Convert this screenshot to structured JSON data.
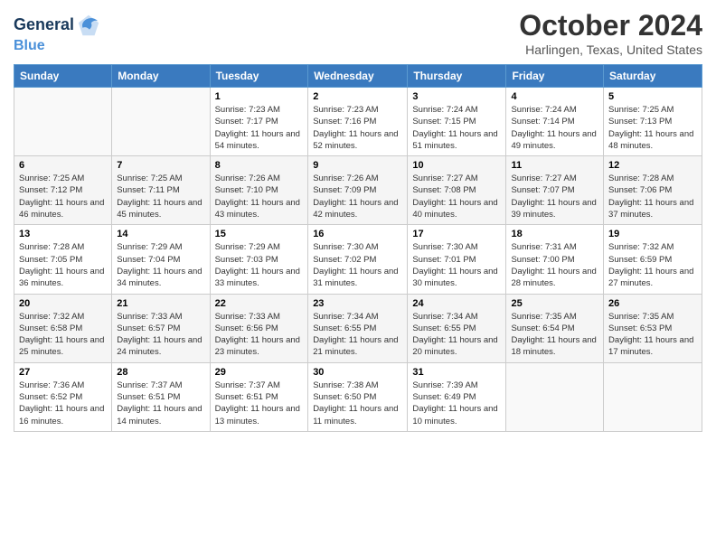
{
  "header": {
    "logo_line1": "General",
    "logo_line2": "Blue",
    "month_title": "October 2024",
    "location": "Harlingen, Texas, United States"
  },
  "weekdays": [
    "Sunday",
    "Monday",
    "Tuesday",
    "Wednesday",
    "Thursday",
    "Friday",
    "Saturday"
  ],
  "weeks": [
    [
      {
        "day": "",
        "sunrise": "",
        "sunset": "",
        "daylight": ""
      },
      {
        "day": "",
        "sunrise": "",
        "sunset": "",
        "daylight": ""
      },
      {
        "day": "1",
        "sunrise": "Sunrise: 7:23 AM",
        "sunset": "Sunset: 7:17 PM",
        "daylight": "Daylight: 11 hours and 54 minutes."
      },
      {
        "day": "2",
        "sunrise": "Sunrise: 7:23 AM",
        "sunset": "Sunset: 7:16 PM",
        "daylight": "Daylight: 11 hours and 52 minutes."
      },
      {
        "day": "3",
        "sunrise": "Sunrise: 7:24 AM",
        "sunset": "Sunset: 7:15 PM",
        "daylight": "Daylight: 11 hours and 51 minutes."
      },
      {
        "day": "4",
        "sunrise": "Sunrise: 7:24 AM",
        "sunset": "Sunset: 7:14 PM",
        "daylight": "Daylight: 11 hours and 49 minutes."
      },
      {
        "day": "5",
        "sunrise": "Sunrise: 7:25 AM",
        "sunset": "Sunset: 7:13 PM",
        "daylight": "Daylight: 11 hours and 48 minutes."
      }
    ],
    [
      {
        "day": "6",
        "sunrise": "Sunrise: 7:25 AM",
        "sunset": "Sunset: 7:12 PM",
        "daylight": "Daylight: 11 hours and 46 minutes."
      },
      {
        "day": "7",
        "sunrise": "Sunrise: 7:25 AM",
        "sunset": "Sunset: 7:11 PM",
        "daylight": "Daylight: 11 hours and 45 minutes."
      },
      {
        "day": "8",
        "sunrise": "Sunrise: 7:26 AM",
        "sunset": "Sunset: 7:10 PM",
        "daylight": "Daylight: 11 hours and 43 minutes."
      },
      {
        "day": "9",
        "sunrise": "Sunrise: 7:26 AM",
        "sunset": "Sunset: 7:09 PM",
        "daylight": "Daylight: 11 hours and 42 minutes."
      },
      {
        "day": "10",
        "sunrise": "Sunrise: 7:27 AM",
        "sunset": "Sunset: 7:08 PM",
        "daylight": "Daylight: 11 hours and 40 minutes."
      },
      {
        "day": "11",
        "sunrise": "Sunrise: 7:27 AM",
        "sunset": "Sunset: 7:07 PM",
        "daylight": "Daylight: 11 hours and 39 minutes."
      },
      {
        "day": "12",
        "sunrise": "Sunrise: 7:28 AM",
        "sunset": "Sunset: 7:06 PM",
        "daylight": "Daylight: 11 hours and 37 minutes."
      }
    ],
    [
      {
        "day": "13",
        "sunrise": "Sunrise: 7:28 AM",
        "sunset": "Sunset: 7:05 PM",
        "daylight": "Daylight: 11 hours and 36 minutes."
      },
      {
        "day": "14",
        "sunrise": "Sunrise: 7:29 AM",
        "sunset": "Sunset: 7:04 PM",
        "daylight": "Daylight: 11 hours and 34 minutes."
      },
      {
        "day": "15",
        "sunrise": "Sunrise: 7:29 AM",
        "sunset": "Sunset: 7:03 PM",
        "daylight": "Daylight: 11 hours and 33 minutes."
      },
      {
        "day": "16",
        "sunrise": "Sunrise: 7:30 AM",
        "sunset": "Sunset: 7:02 PM",
        "daylight": "Daylight: 11 hours and 31 minutes."
      },
      {
        "day": "17",
        "sunrise": "Sunrise: 7:30 AM",
        "sunset": "Sunset: 7:01 PM",
        "daylight": "Daylight: 11 hours and 30 minutes."
      },
      {
        "day": "18",
        "sunrise": "Sunrise: 7:31 AM",
        "sunset": "Sunset: 7:00 PM",
        "daylight": "Daylight: 11 hours and 28 minutes."
      },
      {
        "day": "19",
        "sunrise": "Sunrise: 7:32 AM",
        "sunset": "Sunset: 6:59 PM",
        "daylight": "Daylight: 11 hours and 27 minutes."
      }
    ],
    [
      {
        "day": "20",
        "sunrise": "Sunrise: 7:32 AM",
        "sunset": "Sunset: 6:58 PM",
        "daylight": "Daylight: 11 hours and 25 minutes."
      },
      {
        "day": "21",
        "sunrise": "Sunrise: 7:33 AM",
        "sunset": "Sunset: 6:57 PM",
        "daylight": "Daylight: 11 hours and 24 minutes."
      },
      {
        "day": "22",
        "sunrise": "Sunrise: 7:33 AM",
        "sunset": "Sunset: 6:56 PM",
        "daylight": "Daylight: 11 hours and 23 minutes."
      },
      {
        "day": "23",
        "sunrise": "Sunrise: 7:34 AM",
        "sunset": "Sunset: 6:55 PM",
        "daylight": "Daylight: 11 hours and 21 minutes."
      },
      {
        "day": "24",
        "sunrise": "Sunrise: 7:34 AM",
        "sunset": "Sunset: 6:55 PM",
        "daylight": "Daylight: 11 hours and 20 minutes."
      },
      {
        "day": "25",
        "sunrise": "Sunrise: 7:35 AM",
        "sunset": "Sunset: 6:54 PM",
        "daylight": "Daylight: 11 hours and 18 minutes."
      },
      {
        "day": "26",
        "sunrise": "Sunrise: 7:35 AM",
        "sunset": "Sunset: 6:53 PM",
        "daylight": "Daylight: 11 hours and 17 minutes."
      }
    ],
    [
      {
        "day": "27",
        "sunrise": "Sunrise: 7:36 AM",
        "sunset": "Sunset: 6:52 PM",
        "daylight": "Daylight: 11 hours and 16 minutes."
      },
      {
        "day": "28",
        "sunrise": "Sunrise: 7:37 AM",
        "sunset": "Sunset: 6:51 PM",
        "daylight": "Daylight: 11 hours and 14 minutes."
      },
      {
        "day": "29",
        "sunrise": "Sunrise: 7:37 AM",
        "sunset": "Sunset: 6:51 PM",
        "daylight": "Daylight: 11 hours and 13 minutes."
      },
      {
        "day": "30",
        "sunrise": "Sunrise: 7:38 AM",
        "sunset": "Sunset: 6:50 PM",
        "daylight": "Daylight: 11 hours and 11 minutes."
      },
      {
        "day": "31",
        "sunrise": "Sunrise: 7:39 AM",
        "sunset": "Sunset: 6:49 PM",
        "daylight": "Daylight: 11 hours and 10 minutes."
      },
      {
        "day": "",
        "sunrise": "",
        "sunset": "",
        "daylight": ""
      },
      {
        "day": "",
        "sunrise": "",
        "sunset": "",
        "daylight": ""
      }
    ]
  ]
}
